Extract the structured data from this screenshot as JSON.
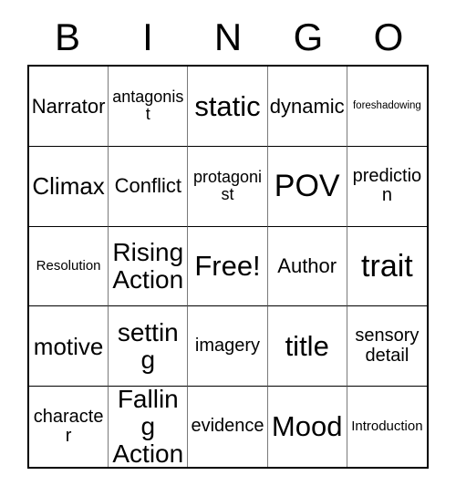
{
  "card": {
    "header_letters": [
      "B",
      "I",
      "N",
      "G",
      "O"
    ],
    "columns": 5,
    "rows": 5,
    "colors": {
      "background": "#ffffff",
      "text": "#000000",
      "horizontal_rule": "#000000",
      "vertical_rule": "#7a7a7a"
    },
    "cells": [
      {
        "text": "Narrator",
        "size": "l"
      },
      {
        "text": "antagonist",
        "size": "m"
      },
      {
        "text": "static",
        "size": "3xl"
      },
      {
        "text": "dynamic",
        "size": "l"
      },
      {
        "text": "foreshadowing",
        "size": "xs"
      },
      {
        "text": "Climax",
        "size": "xl"
      },
      {
        "text": "Conflict",
        "size": "l"
      },
      {
        "text": "protagonist",
        "size": "m"
      },
      {
        "text": "POV",
        "size": "4xl"
      },
      {
        "text": "prediction",
        "size": "ml"
      },
      {
        "text": "Resolution",
        "size": "s"
      },
      {
        "text": "Rising\nAction",
        "size": "2xl"
      },
      {
        "text": "Free!",
        "size": "3xl"
      },
      {
        "text": "Author",
        "size": "l"
      },
      {
        "text": "trait",
        "size": "4xl"
      },
      {
        "text": "motive",
        "size": "xl"
      },
      {
        "text": "setting",
        "size": "2xl"
      },
      {
        "text": "imagery",
        "size": "ml"
      },
      {
        "text": "title",
        "size": "3xl"
      },
      {
        "text": "sensory\ndetail",
        "size": "ml"
      },
      {
        "text": "character",
        "size": "ml"
      },
      {
        "text": "Falling\nAction",
        "size": "2xl"
      },
      {
        "text": "evidence",
        "size": "ml"
      },
      {
        "text": "Mood",
        "size": "3xl"
      },
      {
        "text": "Introduction",
        "size": "s"
      }
    ]
  }
}
